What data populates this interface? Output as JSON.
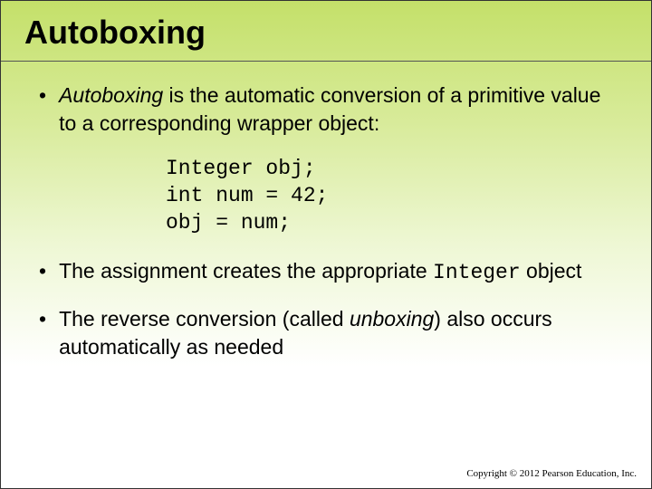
{
  "title": "Autoboxing",
  "bullet1_term": "Autoboxing",
  "bullet1_rest": " is the automatic conversion of a primitive value to a corresponding wrapper object:",
  "code": "Integer obj;\nint num = 42;\nobj = num;",
  "bullet2_pre": "The assignment creates the appropriate ",
  "bullet2_mono": "Integer",
  "bullet2_post": " object",
  "bullet3_pre": "The reverse conversion (called ",
  "bullet3_italic": "unboxing",
  "bullet3_post": ") also occurs automatically as needed",
  "copyright": "Copyright © 2012 Pearson Education, Inc."
}
